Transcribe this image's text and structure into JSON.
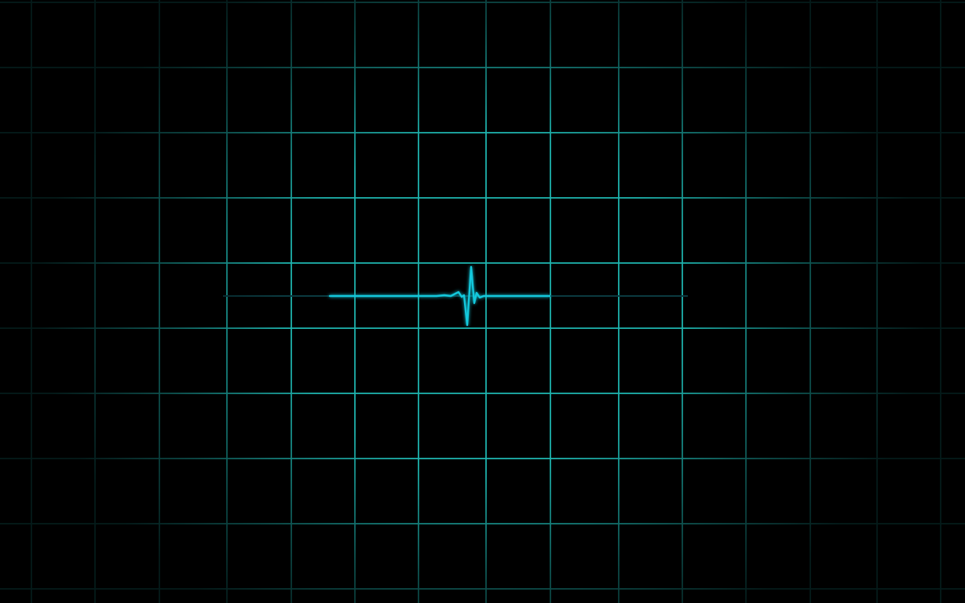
{
  "app": {
    "title": ""
  },
  "colors": {
    "background": "#000000",
    "grid_line": "#1fb3ad",
    "trace": "#13c8dc",
    "baseline": "#0b3a40"
  },
  "icons": {
    "heartbeat": "heartbeat-trace-icon"
  }
}
